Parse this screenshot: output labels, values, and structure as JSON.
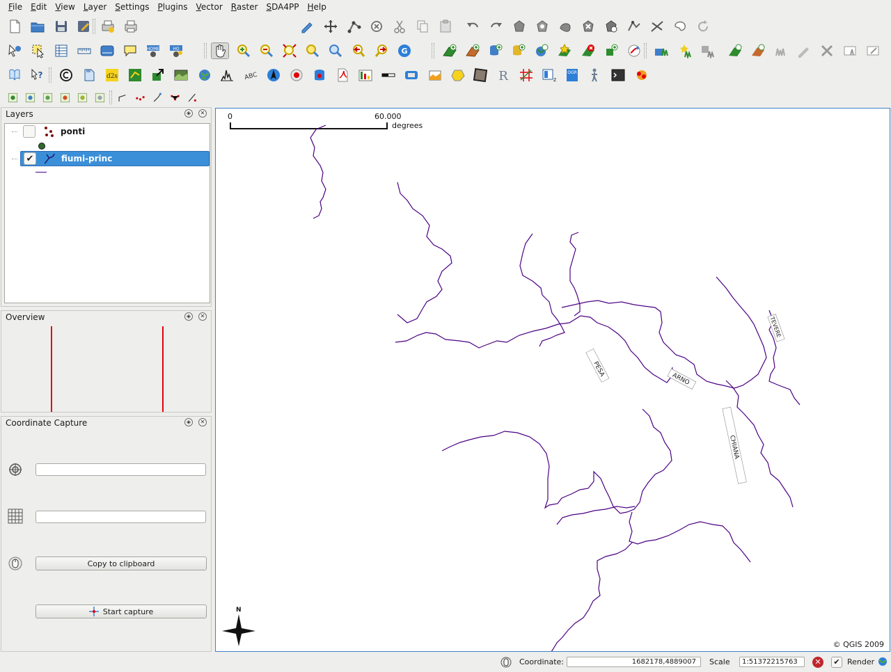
{
  "menubar": {
    "items": [
      "File",
      "Edit",
      "View",
      "Layer",
      "Settings",
      "Plugins",
      "Vector",
      "Raster",
      "SDA4PP",
      "Help"
    ]
  },
  "layers_panel": {
    "title": "Layers",
    "layers": [
      {
        "name": "ponti",
        "checked": false,
        "symbol": "point",
        "color": "#2e6b2e"
      },
      {
        "name": "fiumi-princ",
        "checked": true,
        "symbol": "line",
        "color": "#4b0082"
      }
    ]
  },
  "overview_panel": {
    "title": "Overview"
  },
  "coordinate_capture": {
    "title": "Coordinate Capture",
    "field1_value": "",
    "field2_value": "",
    "copy_button": "Copy to clipboard",
    "start_button": "Start capture"
  },
  "map": {
    "scalebar": {
      "start": "0",
      "end": "60.000",
      "unit": "degrees"
    },
    "north_label": "N",
    "copyright": "© QGIS 2009",
    "river_color": "#4b0082",
    "labels": [
      "PESA",
      "ARNO",
      "CHIANA",
      "TEVERE"
    ]
  },
  "statusbar": {
    "coordinate_label": "Coordinate:",
    "coordinate_value": "1682178,4889007",
    "scale_label": "Scale",
    "scale_value": "1:51372215763",
    "render_label": "Render",
    "render_checked": true
  }
}
